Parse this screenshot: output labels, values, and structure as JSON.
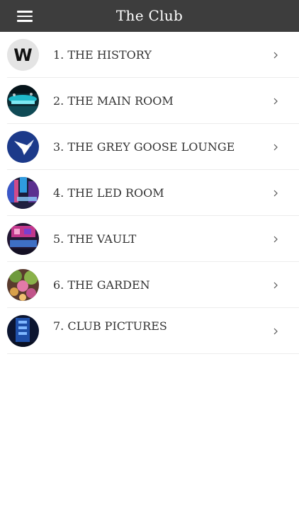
{
  "header": {
    "title": "The Club",
    "menu_icon": "hamburger-menu-icon"
  },
  "menu": {
    "items": [
      {
        "label": "1. THE HISTORY",
        "thumb": "w-logo"
      },
      {
        "label": "2. THE MAIN ROOM",
        "thumb": "main-room-photo"
      },
      {
        "label": "3. THE GREY GOOSE LOUNGE",
        "thumb": "grey-goose-logo"
      },
      {
        "label": "4. THE LED ROOM",
        "thumb": "led-room-photo"
      },
      {
        "label": "5. THE VAULT",
        "thumb": "vault-photo"
      },
      {
        "label": "6. THE GARDEN",
        "thumb": "garden-photo"
      },
      {
        "label": "7. CLUB PICTURES",
        "thumb": "club-pictures-photo"
      }
    ]
  },
  "colors": {
    "navbar": "#3d3d3d",
    "text": "#333333",
    "divider": "#ececec",
    "chevron": "#555555"
  }
}
